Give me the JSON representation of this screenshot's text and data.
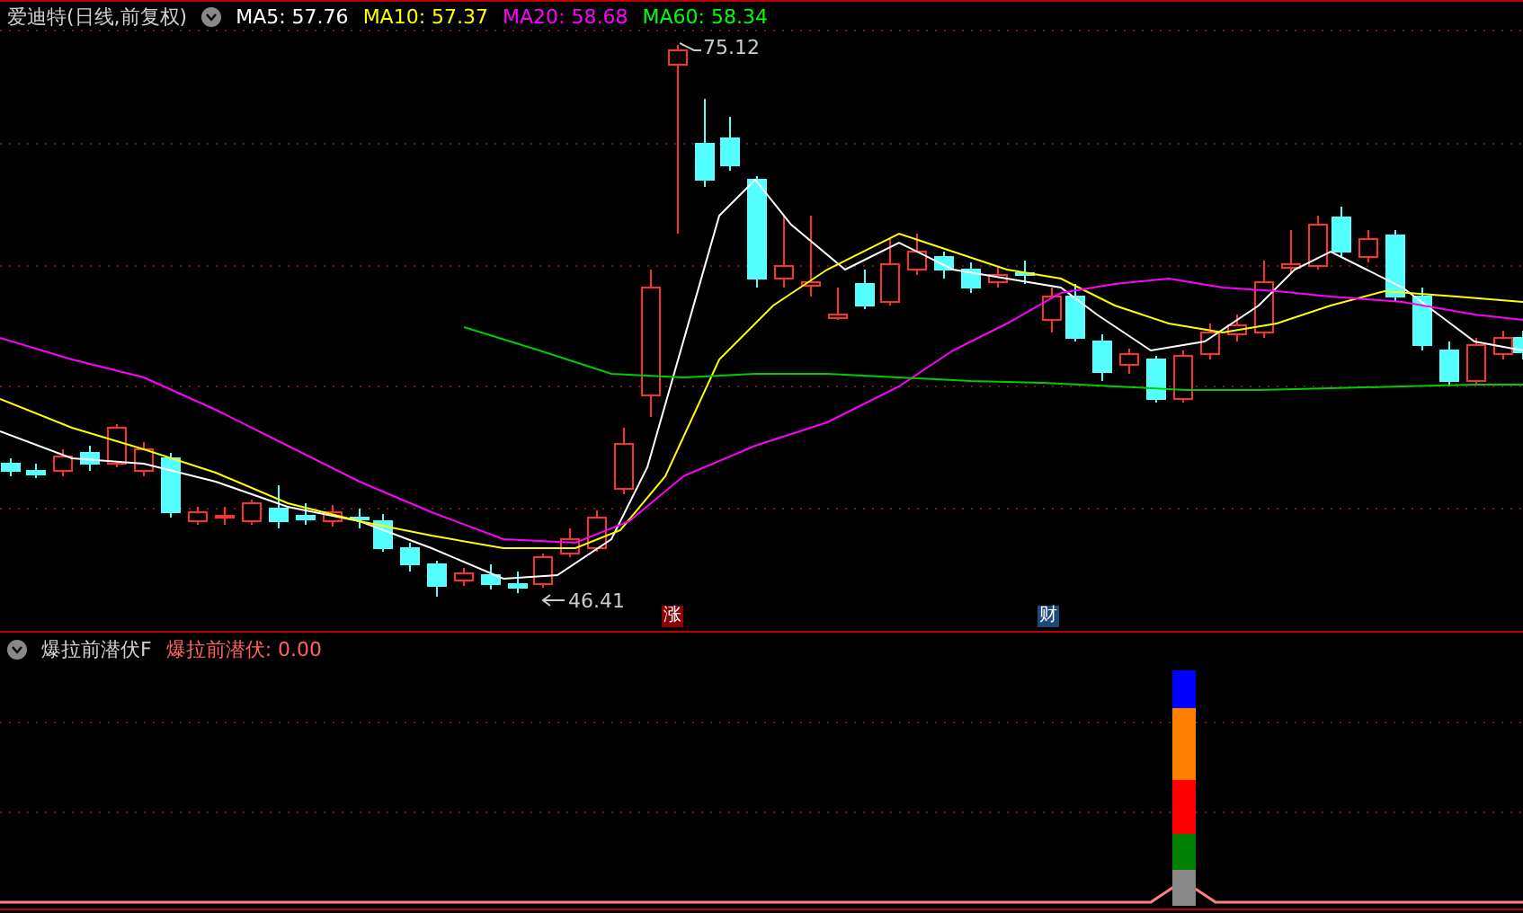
{
  "title": "爱迪特(日线,前复权)",
  "moving_averages": [
    {
      "text": "MA5: 57.76",
      "color": "#ffffff"
    },
    {
      "text": "MA10: 57.37",
      "color": "#ffff00"
    },
    {
      "text": "MA20: 58.68",
      "color": "#ff00ff"
    },
    {
      "text": "MA60: 58.34",
      "color": "#00ff00"
    }
  ],
  "price_markers": [
    {
      "kind": "high",
      "text": "75.12"
    },
    {
      "kind": "low",
      "text": "46.41"
    }
  ],
  "event_badges": [
    {
      "text": "涨",
      "color": "#8b0000"
    },
    {
      "text": "财",
      "color": "#1e4a7a"
    }
  ],
  "indicator": {
    "name": "爆拉前潜伏F",
    "label": "爆拉前潜伏: 0.00"
  }
}
